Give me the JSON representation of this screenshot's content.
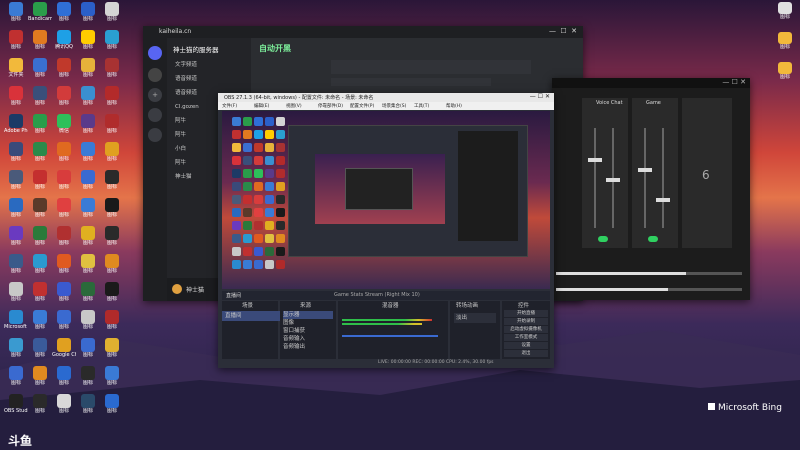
{
  "desktop": {
    "icons": [
      {
        "label": "图标",
        "color": "#3a7bd5"
      },
      {
        "label": "Bandicam",
        "color": "#2a9d4a"
      },
      {
        "label": "图标",
        "color": "#2f6fd6"
      },
      {
        "label": "图标",
        "color": "#2b5fc9"
      },
      {
        "label": "图标",
        "color": "#d4d4d4"
      },
      {
        "label": "图标",
        "color": "#c03030"
      },
      {
        "label": "图标",
        "color": "#e07a20"
      },
      {
        "label": "腾讯QQ",
        "color": "#1ea0e6"
      },
      {
        "label": "图标",
        "color": "#ffcc00"
      },
      {
        "label": "图标",
        "color": "#2a9fd0"
      },
      {
        "label": "文件夹",
        "color": "#f2b93b"
      },
      {
        "label": "图标",
        "color": "#3a6fd0"
      },
      {
        "label": "图标",
        "color": "#c0392b"
      },
      {
        "label": "图标",
        "color": "#e6b23a"
      },
      {
        "label": "图标",
        "color": "#a83232"
      },
      {
        "label": "图标",
        "color": "#d9323a"
      },
      {
        "label": "图标",
        "color": "#3a4f7a"
      },
      {
        "label": "图标",
        "color": "#d23b3b"
      },
      {
        "label": "图标",
        "color": "#3a8fd0"
      },
      {
        "label": "图标",
        "color": "#b32a2a"
      },
      {
        "label": "Adobe Photoshop",
        "color": "#1c3a66"
      },
      {
        "label": "图标",
        "color": "#2a9d4a"
      },
      {
        "label": "微信",
        "color": "#2dc05a"
      },
      {
        "label": "图标",
        "color": "#5a3a8a"
      },
      {
        "label": "图标",
        "color": "#b02c2c"
      },
      {
        "label": "图标",
        "color": "#3a4a7a"
      },
      {
        "label": "图标",
        "color": "#2a8a4a"
      },
      {
        "label": "图标",
        "color": "#e06a20"
      },
      {
        "label": "图标",
        "color": "#3a7bd5"
      },
      {
        "label": "图标",
        "color": "#e0a020"
      },
      {
        "label": "图标",
        "color": "#4a5a7a"
      },
      {
        "label": "图标",
        "color": "#c42f2f"
      },
      {
        "label": "图标",
        "color": "#d83c3c"
      },
      {
        "label": "图标",
        "color": "#3a6ad0"
      },
      {
        "label": "图标",
        "color": "#2a2a2a"
      },
      {
        "label": "图标",
        "color": "#2a6ac0"
      },
      {
        "label": "图标",
        "color": "#5a3a2a"
      },
      {
        "label": "图标",
        "color": "#e04040"
      },
      {
        "label": "图标",
        "color": "#3a7bd5"
      },
      {
        "label": "图标",
        "color": "#1a1a1a"
      },
      {
        "label": "图标",
        "color": "#6a3ac0"
      },
      {
        "label": "图标",
        "color": "#2a7a3a"
      },
      {
        "label": "图标",
        "color": "#b03030"
      },
      {
        "label": "图标",
        "color": "#e0b020"
      },
      {
        "label": "图标",
        "color": "#2a2a2a"
      },
      {
        "label": "图标",
        "color": "#3a5a8a"
      },
      {
        "label": "图标",
        "color": "#2a9ad0"
      },
      {
        "label": "图标",
        "color": "#e05a20"
      },
      {
        "label": "图标",
        "color": "#e0c040"
      },
      {
        "label": "图标",
        "color": "#e08a20"
      },
      {
        "label": "图标",
        "color": "#c8c8c8"
      },
      {
        "label": "图标",
        "color": "#c03030"
      },
      {
        "label": "图标",
        "color": "#3a5ad0"
      },
      {
        "label": "图标",
        "color": "#2a6a3a"
      },
      {
        "label": "图标",
        "color": "#1a1a1a"
      },
      {
        "label": "Microsoft Edge",
        "color": "#2a8ad0"
      },
      {
        "label": "图标",
        "color": "#3a7bd5"
      },
      {
        "label": "图标",
        "color": "#3a6ad0"
      },
      {
        "label": "图标",
        "color": "#c8c8c8"
      },
      {
        "label": "图标",
        "color": "#b02a2a"
      },
      {
        "label": "图标",
        "color": "#3a9ad0"
      },
      {
        "label": "图标",
        "color": "#3a5a9a"
      },
      {
        "label": "Google Chrome",
        "color": "#e0a020"
      },
      {
        "label": "图标",
        "color": "#3a6ad0"
      },
      {
        "label": "图标",
        "color": "#e0b030"
      },
      {
        "label": "图标",
        "color": "#3a6ad0"
      },
      {
        "label": "图标",
        "color": "#e08a20"
      },
      {
        "label": "图标",
        "color": "#2a6ad0"
      },
      {
        "label": "图标",
        "color": "#2a2a2a"
      },
      {
        "label": "图标",
        "color": "#3a7ad5"
      },
      {
        "label": "OBS Studio",
        "color": "#222"
      },
      {
        "label": "图标",
        "color": "#2a2a2a"
      },
      {
        "label": "图标",
        "color": "#d8d8d8"
      },
      {
        "label": "图标",
        "color": "#2a4a6a"
      },
      {
        "label": "图标",
        "color": "#2a6ad0"
      }
    ],
    "right_icons": [
      {
        "label": "图标",
        "color": "#e0e0e0"
      },
      {
        "label": "图标",
        "color": "#f2b93b"
      },
      {
        "label": "图标",
        "color": "#f2b93b"
      }
    ],
    "bing_label": "Microsoft Bing",
    "taskbar_logo": "斗鱼"
  },
  "kook": {
    "title": "kaiheila.cn",
    "server": "神士猫的服务器",
    "logo": "自动开黑",
    "channels": [
      "文字频道",
      "语音频道",
      "语音频道",
      "Cl.gozen",
      "阿牛",
      "阿牛",
      "小白",
      "阿牛",
      "神士猫"
    ],
    "user": "神士猫"
  },
  "obs": {
    "title": "OBS 27.1.3 (64-bit, windows) - 配置文件: 未命名 - 场景: 未命名",
    "menu": [
      "文件(F)",
      "编辑(E)",
      "视图(V)",
      "停靠部件(D)",
      "配置文件(P)",
      "场景集合(S)",
      "工具(T)",
      "帮助(H)"
    ],
    "scene_label": "直播间",
    "panels": [
      "场景",
      "来源",
      "混音器",
      "转场动画",
      "控件"
    ],
    "sources": [
      "显示器",
      "图像",
      "窗口捕获",
      "音频输入",
      "音频输出"
    ],
    "controls": [
      "开始直播",
      "开始录制",
      "启动虚拟摄像机",
      "工作室模式",
      "设置",
      "退出"
    ],
    "statusbar": "LIVE: 00:00:00  REC: 00:00:00  CPU: 2.4%, 30.00 fps",
    "transition": "淡出",
    "preview_tag": "Game Stats Stream (Right Mix 10)"
  },
  "mixer": {
    "channels": [
      "Voice Chat",
      "Game",
      "6"
    ]
  }
}
